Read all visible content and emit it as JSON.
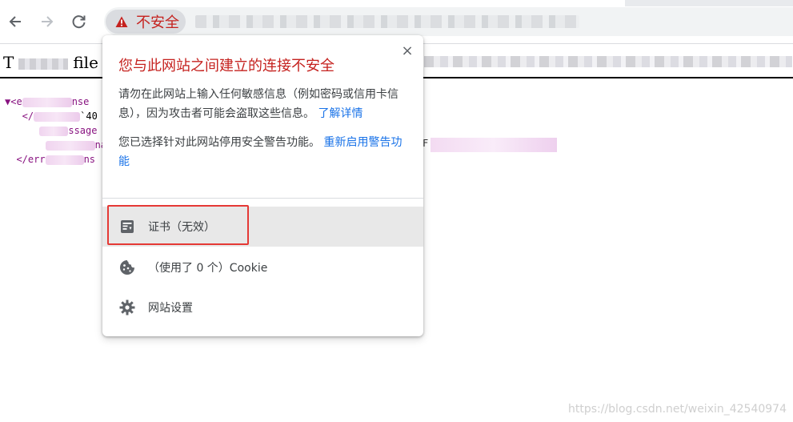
{
  "browser": {
    "security_label": "不安全"
  },
  "page": {
    "heading_prefix": "T",
    "heading_word": "file",
    "xml_lines": [
      {
        "prefix": "▼<e",
        "suffix": "nse"
      },
      {
        "prefix": "   </",
        "suffix": "`40"
      },
      {
        "prefix": "      ",
        "suffix": "ssage"
      },
      {
        "prefix": "       ",
        "suffix": "na"
      },
      {
        "prefix": "  </err",
        "suffix": "ns"
      }
    ],
    "right_char": "F"
  },
  "popup": {
    "title": "您与此网站之间建立的连接不安全",
    "warning_text": "请勿在此网站上输入任何敏感信息（例如密码或信用卡信息），因为攻击者可能会盗取这些信息。",
    "learn_more": "了解详情",
    "disabled_text": "您已选择针对此网站停用安全警告功能。",
    "reenable_link": "重新启用警告功能",
    "close_symbol": "×",
    "items": [
      {
        "label": "证书（无效）",
        "icon": "certificate-icon"
      },
      {
        "label": "（使用了 0 个）Cookie",
        "icon": "cookie-icon"
      },
      {
        "label": "网站设置",
        "icon": "gear-icon"
      }
    ]
  },
  "watermark": "https://blog.csdn.net/weixin_42540974",
  "colors": {
    "danger": "#c5221f",
    "link": "#1a73e8",
    "highlight": "#e53935"
  }
}
